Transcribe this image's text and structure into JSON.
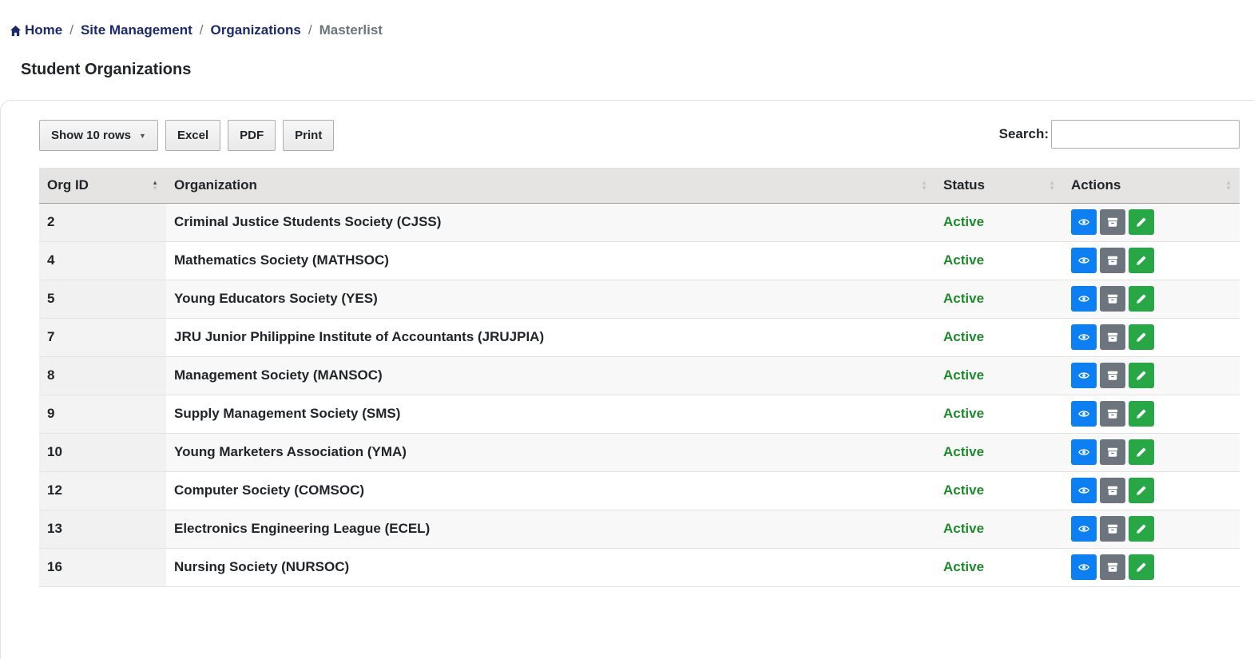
{
  "breadcrumb": {
    "home": "Home",
    "site_management": "Site Management",
    "organizations": "Organizations",
    "current": "Masterlist",
    "separator": "/"
  },
  "page": {
    "title": "Student Organizations"
  },
  "toolbar": {
    "show_rows": "Show 10 rows",
    "excel": "Excel",
    "pdf": "PDF",
    "print": "Print"
  },
  "search": {
    "label": "Search:",
    "value": ""
  },
  "table": {
    "headers": {
      "org_id": "Org ID",
      "organization": "Organization",
      "status": "Status",
      "actions": "Actions"
    },
    "rows": [
      {
        "id": "2",
        "name": "Criminal Justice Students Society (CJSS)",
        "status": "Active"
      },
      {
        "id": "4",
        "name": "Mathematics Society (MATHSOC)",
        "status": "Active"
      },
      {
        "id": "5",
        "name": "Young Educators Society (YES)",
        "status": "Active"
      },
      {
        "id": "7",
        "name": "JRU Junior Philippine Institute of Accountants (JRUJPIA)",
        "status": "Active"
      },
      {
        "id": "8",
        "name": "Management Society (MANSOC)",
        "status": "Active"
      },
      {
        "id": "9",
        "name": "Supply Management Society (SMS)",
        "status": "Active"
      },
      {
        "id": "10",
        "name": "Young Marketers Association (YMA)",
        "status": "Active"
      },
      {
        "id": "12",
        "name": "Computer Society (COMSOC)",
        "status": "Active"
      },
      {
        "id": "13",
        "name": "Electronics Engineering League (ECEL)",
        "status": "Active"
      },
      {
        "id": "16",
        "name": "Nursing Society (NURSOC)",
        "status": "Active"
      }
    ]
  },
  "icons": {
    "view": "eye-icon",
    "archive": "archive-icon",
    "edit": "pencil-icon",
    "home": "home-icon"
  },
  "colors": {
    "link": "#1b2a6b",
    "active_status": "#1d8a2a",
    "view_button": "#0d7ff5",
    "archive_button": "#6c757d",
    "edit_button": "#28a745"
  }
}
